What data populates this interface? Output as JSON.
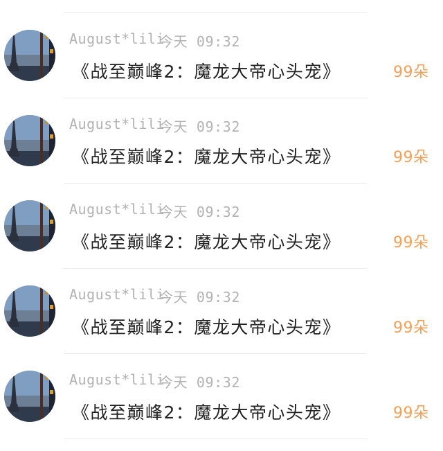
{
  "messages": [
    {
      "avatar": "paris-eiffel-tower-photo",
      "name": "August*lili",
      "time": "今天 09:32",
      "content": "《战至巅峰2：魔龙大帝心头宠》",
      "amount": "99朵"
    },
    {
      "avatar": "paris-eiffel-tower-photo",
      "name": "August*lili",
      "time": "今天 09:32",
      "content": "《战至巅峰2：魔龙大帝心头宠》",
      "amount": "99朵"
    },
    {
      "avatar": "paris-eiffel-tower-photo",
      "name": "August*lili",
      "time": "今天 09:32",
      "content": "《战至巅峰2：魔龙大帝心头宠》",
      "amount": "99朵"
    },
    {
      "avatar": "paris-eiffel-tower-photo",
      "name": "August*lili",
      "time": "今天 09:32",
      "content": "《战至巅峰2：魔龙大帝心头宠》",
      "amount": "99朵"
    },
    {
      "avatar": "paris-eiffel-tower-photo",
      "name": "August*lili",
      "time": "今天 09:32",
      "content": "《战至巅峰2：魔龙大帝心头宠》",
      "amount": "99朵"
    }
  ],
  "colors": {
    "name_text": "#b2b2b2",
    "content_text": "#222222",
    "amount_text": "#f0a15b",
    "divider": "#ececec"
  }
}
